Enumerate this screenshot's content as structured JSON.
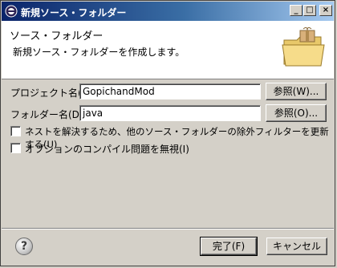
{
  "window": {
    "title": "新規ソース・フォルダー",
    "minimize_icon": "minimize-icon",
    "maximize_icon": "maximize-icon",
    "close_icon": "close-icon"
  },
  "banner": {
    "title": "ソース・フォルダー",
    "message": "新規ソース・フォルダーを作成します。",
    "icon": "folder-package-icon"
  },
  "form": {
    "project_label": "プロジェクト名(P):",
    "project_value": "GopichandMod",
    "project_browse": "参照(W)...",
    "folder_label": "フォルダー名(D):",
    "folder_value": "java",
    "folder_browse": "参照(O)...",
    "nest_update_label": "ネストを解決するため、他のソース・フォルダーの除外フィルターを更新する(U)",
    "ignore_problems_label": "オプションのコンパイル問題を無視(I)"
  },
  "footer": {
    "finish_label": "完了(F)",
    "cancel_label": "キャンセル",
    "help_icon": "help-icon"
  },
  "colors": {
    "titlebar_start": "#0a246a",
    "titlebar_end": "#a6caf0",
    "dialog_bg": "#d4d0c8"
  }
}
